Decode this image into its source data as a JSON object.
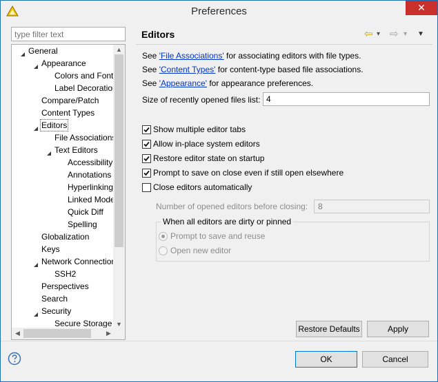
{
  "window": {
    "title": "Preferences",
    "close_glyph": "✕"
  },
  "filter": {
    "placeholder": "type filter text"
  },
  "tree": [
    {
      "label": "General",
      "depth": 0,
      "twisty": "expanded"
    },
    {
      "label": "Appearance",
      "depth": 1,
      "twisty": "expanded"
    },
    {
      "label": "Colors and Fonts",
      "depth": 2,
      "twisty": "none"
    },
    {
      "label": "Label Decorations",
      "depth": 2,
      "twisty": "none"
    },
    {
      "label": "Compare/Patch",
      "depth": 1,
      "twisty": "none"
    },
    {
      "label": "Content Types",
      "depth": 1,
      "twisty": "none"
    },
    {
      "label": "Editors",
      "depth": 1,
      "twisty": "expanded",
      "selected": true
    },
    {
      "label": "File Associations",
      "depth": 2,
      "twisty": "none"
    },
    {
      "label": "Text Editors",
      "depth": 2,
      "twisty": "expanded"
    },
    {
      "label": "Accessibility",
      "depth": 3,
      "twisty": "none"
    },
    {
      "label": "Annotations",
      "depth": 3,
      "twisty": "none"
    },
    {
      "label": "Hyperlinking",
      "depth": 3,
      "twisty": "none"
    },
    {
      "label": "Linked Mode",
      "depth": 3,
      "twisty": "none"
    },
    {
      "label": "Quick Diff",
      "depth": 3,
      "twisty": "none"
    },
    {
      "label": "Spelling",
      "depth": 3,
      "twisty": "none"
    },
    {
      "label": "Globalization",
      "depth": 1,
      "twisty": "none"
    },
    {
      "label": "Keys",
      "depth": 1,
      "twisty": "none"
    },
    {
      "label": "Network Connections",
      "depth": 1,
      "twisty": "expanded"
    },
    {
      "label": "SSH2",
      "depth": 2,
      "twisty": "none"
    },
    {
      "label": "Perspectives",
      "depth": 1,
      "twisty": "none"
    },
    {
      "label": "Search",
      "depth": 1,
      "twisty": "none"
    },
    {
      "label": "Security",
      "depth": 1,
      "twisty": "expanded"
    },
    {
      "label": "Secure Storage",
      "depth": 2,
      "twisty": "none"
    }
  ],
  "page": {
    "title": "Editors",
    "nav_back_glyph": "⇦",
    "nav_forward_glyph": "⇨",
    "nav_dropdown_glyph": "▾",
    "menu_glyph": "▼",
    "links": [
      {
        "pre": "See ",
        "link": "'File Associations'",
        "post": " for associating editors with file types."
      },
      {
        "pre": "See ",
        "link": "'Content Types'",
        "post": " for content-type based file associations."
      },
      {
        "pre": "See ",
        "link": "'Appearance'",
        "post": " for appearance preferences."
      }
    ],
    "recent_files_label": "Size of recently opened files list:",
    "recent_files_value": "4",
    "checkboxes": [
      {
        "label": "Show multiple editor tabs",
        "checked": true
      },
      {
        "label": "Allow in-place system editors",
        "checked": true
      },
      {
        "label": "Restore editor state on startup",
        "checked": true
      },
      {
        "label": "Prompt to save on close even if still open elsewhere",
        "checked": true
      },
      {
        "label": "Close editors automatically",
        "checked": false
      }
    ],
    "opened_editors_label": "Number of opened editors before closing:",
    "opened_editors_value": "8",
    "dirty_group": {
      "title": "When all editors are dirty or pinned",
      "options": [
        {
          "label": "Prompt to save and reuse",
          "selected": true
        },
        {
          "label": "Open new editor",
          "selected": false
        }
      ]
    },
    "restore_defaults_label": "Restore Defaults",
    "apply_label": "Apply"
  },
  "footer": {
    "ok_label": "OK",
    "cancel_label": "Cancel"
  },
  "colors": {
    "link": "#0033cc",
    "close_button": "#c9302c",
    "focus_border": "#0078d7",
    "icon_yellow": "#f5c400"
  }
}
